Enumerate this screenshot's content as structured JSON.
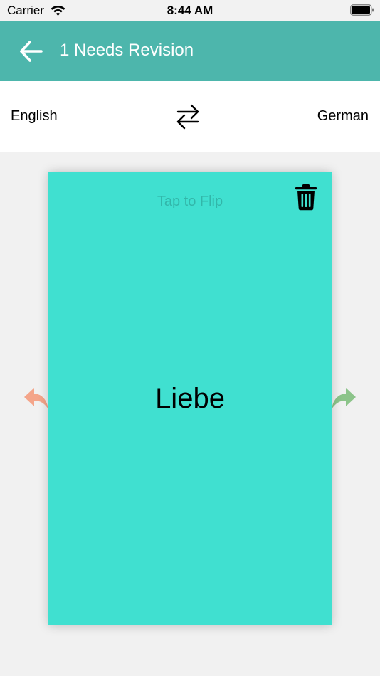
{
  "status_bar": {
    "carrier": "Carrier",
    "time": "8:44 AM"
  },
  "nav": {
    "title": "1 Needs Revision",
    "back_icon": "arrow-left-icon"
  },
  "language_bar": {
    "source_language": "English",
    "target_language": "German",
    "swap_icon": "swap-arrows-icon"
  },
  "card": {
    "hint": "Tap to Flip",
    "word": "Liebe",
    "delete_icon": "trash-icon",
    "background_color": "#40e0d0"
  },
  "navigation_arrows": {
    "previous_icon": "reply-arrow-icon",
    "next_icon": "forward-arrow-icon",
    "previous_color": "#f4a58a",
    "next_color": "#8cc48a"
  },
  "colors": {
    "nav_bar": "#4db6ac",
    "background": "#f1f1f1"
  }
}
